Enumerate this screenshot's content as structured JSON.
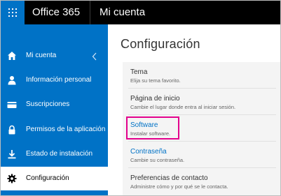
{
  "colors": {
    "brand_blue": "#0072c6",
    "highlight": "#e3008c",
    "top_bar": "#000000"
  },
  "header": {
    "app_name": "Office 365",
    "page_title": "Mi cuenta",
    "waffle_icon": "app-launcher-icon"
  },
  "sidebar": {
    "collapse_icon": "chevron-left-icon",
    "items": [
      {
        "label": "Mi cuenta",
        "icon": "home-icon"
      },
      {
        "label": "Información personal",
        "icon": "person-icon"
      },
      {
        "label": "Suscripciones",
        "icon": "credit-card-icon"
      },
      {
        "label": "Permisos de la aplicación",
        "icon": "lock-icon"
      },
      {
        "label": "Estado de instalación",
        "icon": "download-icon"
      },
      {
        "label": "Configuración",
        "icon": "gear-icon",
        "active": true
      }
    ]
  },
  "main": {
    "title": "Configuración",
    "settings": [
      {
        "title": "Tema",
        "description": "Elija su tema favorito."
      },
      {
        "title": "Página de inicio",
        "description": "Cambie el lugar donde entra al iniciar sesión."
      },
      {
        "title": "Software",
        "description": "Instalar software.",
        "highlighted": true
      },
      {
        "title": "Contraseña",
        "description": "Cambie su contraseña."
      },
      {
        "title": "Preferencias de contacto",
        "description": "Administre cómo y por qué se le contacta."
      }
    ]
  }
}
